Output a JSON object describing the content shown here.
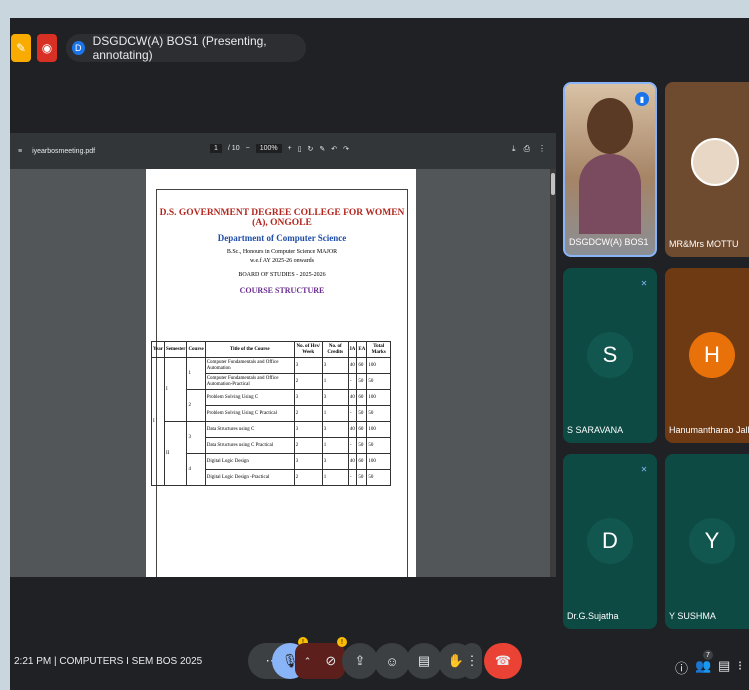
{
  "topbar": {
    "title": "DSGDCW(A) BOS1 (Presenting, annotating)",
    "avatar_letter": "D",
    "notes_icon": "notes-icon",
    "record_icon": "record-icon"
  },
  "pdf": {
    "filename": "iyearbosmeeting.pdf",
    "page_current": "1",
    "page_total": "/ 10",
    "zoom": "100%",
    "college": "D.S. GOVERNMENT DEGREE COLLEGE FOR WOMEN (A), ONGOLE",
    "department": "Department of Computer Science",
    "program": "B.Sc., Honours in Computer Science MAJOR",
    "wef": "w.e.f AY 2025-26 onwards",
    "board": "BOARD OF STUDIES - 2025-2026",
    "structure": "COURSE STRUCTURE",
    "table": {
      "headers": [
        "Year",
        "Semester",
        "Course",
        "Title of the Course",
        "No. of Hrs/ Week",
        "No. of Credits",
        "IA",
        "EA",
        "Total Marks"
      ],
      "year": "I",
      "semesters": [
        "I",
        "II"
      ],
      "courses": [
        "1",
        "2",
        "3",
        "4"
      ],
      "rows": [
        {
          "title": "Computer Fundamentals and Office Automation",
          "hrs": "3",
          "credits": "3",
          "ia": "40",
          "ea": "60",
          "total": "100"
        },
        {
          "title": "Computer Fundamentals and Office Automation-Practical",
          "hrs": "2",
          "credits": "1",
          "ia": "-",
          "ea": "50",
          "total": "50"
        },
        {
          "title": "Problem Solving Using C",
          "hrs": "3",
          "credits": "3",
          "ia": "40",
          "ea": "60",
          "total": "100"
        },
        {
          "title": "Problem Solving Using C Practical",
          "hrs": "2",
          "credits": "1",
          "ia": "-",
          "ea": "50",
          "total": "50"
        },
        {
          "title": "Data Structures using C",
          "hrs": "3",
          "credits": "3",
          "ia": "40",
          "ea": "60",
          "total": "100"
        },
        {
          "title": "Data Structures using C Practical",
          "hrs": "2",
          "credits": "1",
          "ia": "-",
          "ea": "50",
          "total": "50"
        },
        {
          "title": "Digital Logic Design",
          "hrs": "3",
          "credits": "3",
          "ia": "40",
          "ea": "60",
          "total": "100"
        },
        {
          "title": "Digital Logic Design -Practical",
          "hrs": "2",
          "credits": "1",
          "ia": "-",
          "ea": "50",
          "total": "50"
        }
      ]
    }
  },
  "participants": [
    {
      "name": "DSGDCW(A) BOS1",
      "type": "video",
      "color": "#c7a98a"
    },
    {
      "name": "MR&Mrs MOTTU",
      "type": "image",
      "color": "#6e4a2e"
    },
    {
      "name": "S SARAVANA",
      "letter": "S",
      "color": "#0d4a44",
      "avatar": "#12574f"
    },
    {
      "name": "Hanumantharao Jalla",
      "letter": "H",
      "color": "#6e3a14",
      "avatar": "#e8710a"
    },
    {
      "name": "Dr.G.Sujatha",
      "letter": "D",
      "color": "#0d4a44",
      "avatar": "#12574f"
    },
    {
      "name": "Y SUSHMA",
      "letter": "Y",
      "color": "#0d4a44",
      "avatar": "#12574f"
    }
  ],
  "bottom": {
    "time": "2:21 PM",
    "separator": "|",
    "meeting": "COMPUTERS I SEM BOS 2025",
    "people_count": "7",
    "mic_badge": "!",
    "cam_badge": "!"
  },
  "colors": {
    "end_call": "#ea4335",
    "mic_active": "#8ab4f8",
    "cam_off": "#5c1f1b"
  }
}
